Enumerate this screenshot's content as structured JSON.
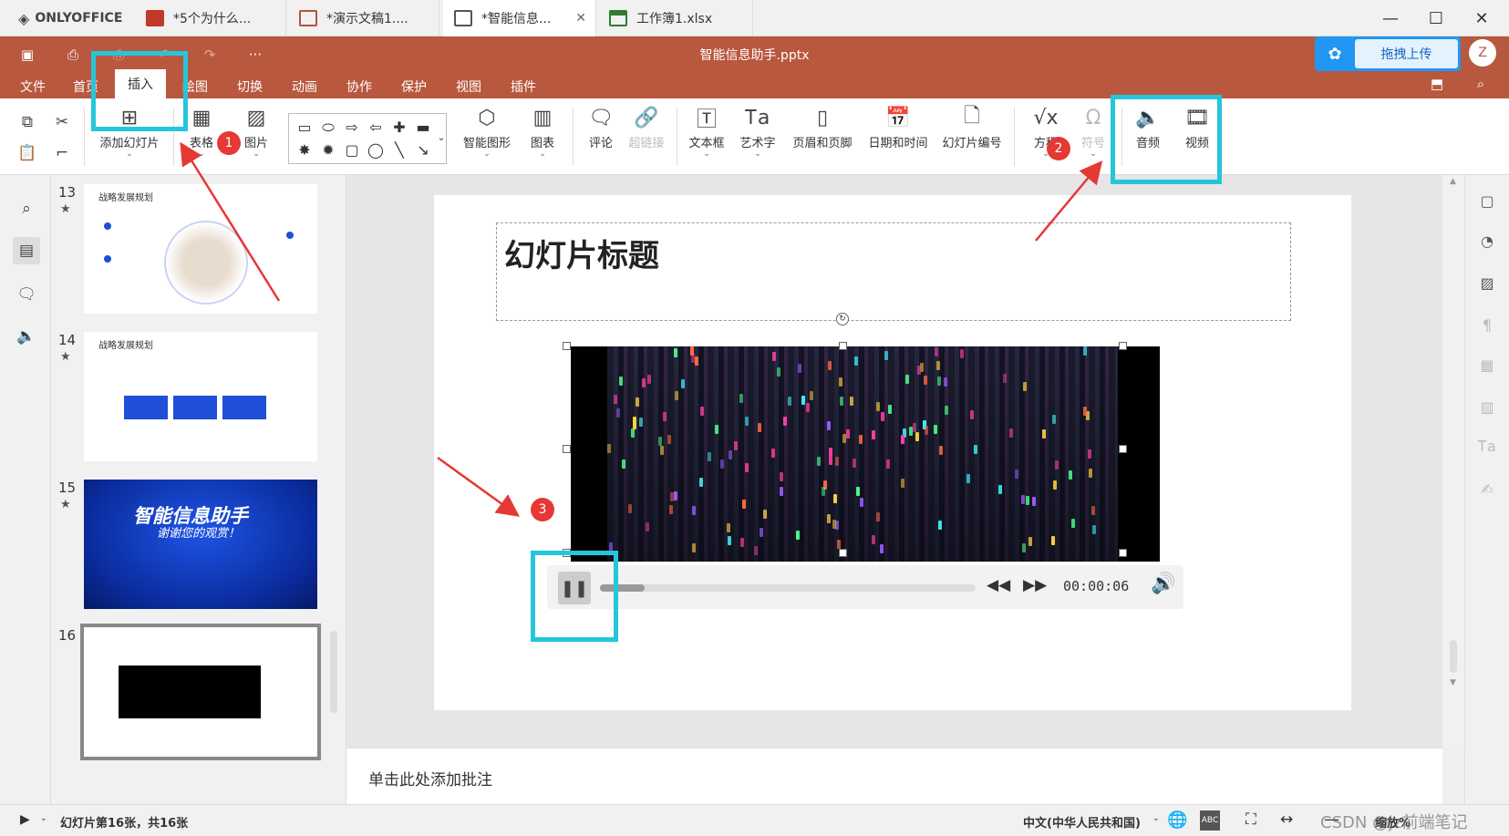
{
  "app": {
    "name": "ONLYOFFICE"
  },
  "tabs": [
    {
      "label": "*5个为什么...",
      "kind": "pres-red",
      "active": false
    },
    {
      "label": "*演示文稿1....",
      "kind": "pres",
      "active": false
    },
    {
      "label": "*智能信息...",
      "kind": "pres",
      "active": true
    },
    {
      "label": "工作簿1.xlsx",
      "kind": "sheet",
      "active": false
    }
  ],
  "window_controls": {
    "minimize": "—",
    "maximize": "☐",
    "close": "✕"
  },
  "document": {
    "title": "智能信息助手.pptx"
  },
  "quick_access": {
    "more": "···"
  },
  "upload": {
    "label": "拖拽上传"
  },
  "user": {
    "initial": "Z"
  },
  "menu": [
    "文件",
    "首页",
    "插入",
    "绘图",
    "切换",
    "动画",
    "协作",
    "保护",
    "视图",
    "插件"
  ],
  "menu_active": "插入",
  "toolbar": {
    "add_slide": "添加幻灯片",
    "table": "表格",
    "image": "图片",
    "smartart": "智能图形",
    "chart": "图表",
    "comment": "评论",
    "hyperlink": "超链接",
    "textbox": "文本框",
    "textart": "艺术字",
    "header_footer": "页眉和页脚",
    "datetime": "日期和时间",
    "slide_number": "幻灯片编号",
    "equation": "方程",
    "symbol": "符号",
    "audio": "音频",
    "video": "视频"
  },
  "thumbnails": [
    {
      "num": "13",
      "title": "战略发展规划"
    },
    {
      "num": "14",
      "title": "战略发展规划"
    },
    {
      "num": "15",
      "title": "智能信息助手",
      "subtitle": "谢谢您的观赏！"
    },
    {
      "num": "16"
    }
  ],
  "slide": {
    "title": "幻灯片标题",
    "video": {
      "time": "00:00:06",
      "progress": 0.12
    }
  },
  "notes": {
    "placeholder": "单击此处添加批注"
  },
  "status": {
    "slide_info": "幻灯片第16张，共16张",
    "language": "中文(中华人民共和国)",
    "zoom_label": "缩放%",
    "watermark": "CSDN @jz前端笔记"
  },
  "annotations": {
    "badge1": "1",
    "badge2": "2",
    "badge3": "3"
  },
  "colors": {
    "header": "#b8583e",
    "highlight": "#26c6da",
    "badge": "#e53935",
    "upload": "#2196f3"
  }
}
